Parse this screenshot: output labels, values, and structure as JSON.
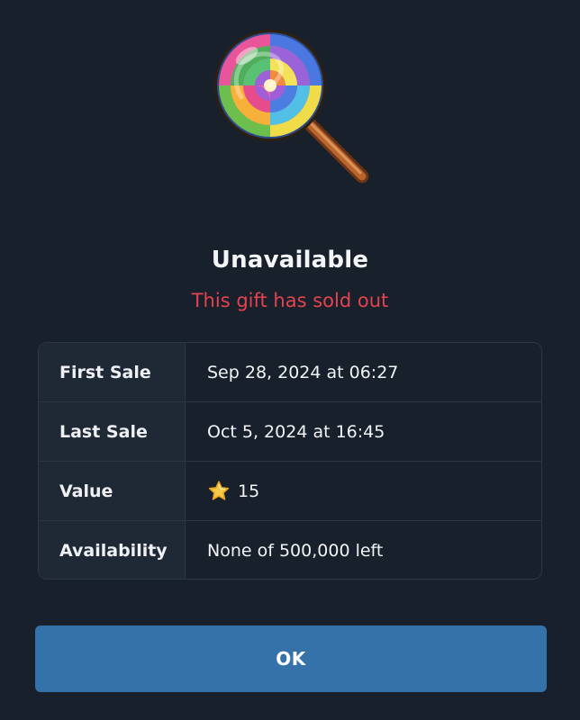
{
  "gift": {
    "icon": "lollipop-icon",
    "title": "Unavailable",
    "status_text": "This gift has sold out",
    "status_color": "#e5434f"
  },
  "details": {
    "rows": [
      {
        "label": "First Sale",
        "value": "Sep 28, 2024 at 06:27"
      },
      {
        "label": "Last Sale",
        "value": "Oct 5, 2024 at 16:45"
      },
      {
        "label": "Value",
        "value": "15",
        "icon": "star-icon"
      },
      {
        "label": "Availability",
        "value": "None of 500,000 left"
      }
    ]
  },
  "actions": {
    "ok_label": "OK",
    "ok_color": "#3672aa"
  },
  "theme": {
    "background": "#17202b",
    "label_background": "#1f2935",
    "border": "#2c3744"
  }
}
